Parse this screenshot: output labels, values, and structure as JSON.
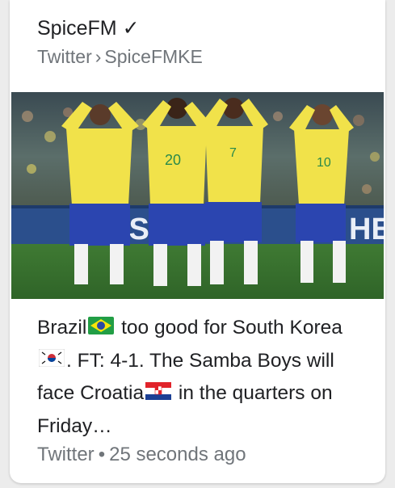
{
  "card": {
    "source_name": "SpiceFM",
    "verified_mark": "✓",
    "platform": "Twitter",
    "path_separator": "›",
    "account": "SpiceFMKE"
  },
  "image": {
    "alt": "Brazil players dancing to celebrate a goal",
    "banner_text": "USA",
    "banner_text_2": "HE",
    "player_numbers": [
      "20",
      "7",
      "10"
    ]
  },
  "snippet": {
    "part1": "Brazil",
    "part2": " too good for South Korea",
    "part3": ". FT: 4-1. The Samba Boys will face Croatia",
    "part4": " in the quarters on Friday…",
    "flags": [
      "brazil-flag",
      "south-korea-flag",
      "croatia-flag"
    ]
  },
  "footer": {
    "platform": "Twitter",
    "dot": "•",
    "time": "25 seconds ago"
  }
}
